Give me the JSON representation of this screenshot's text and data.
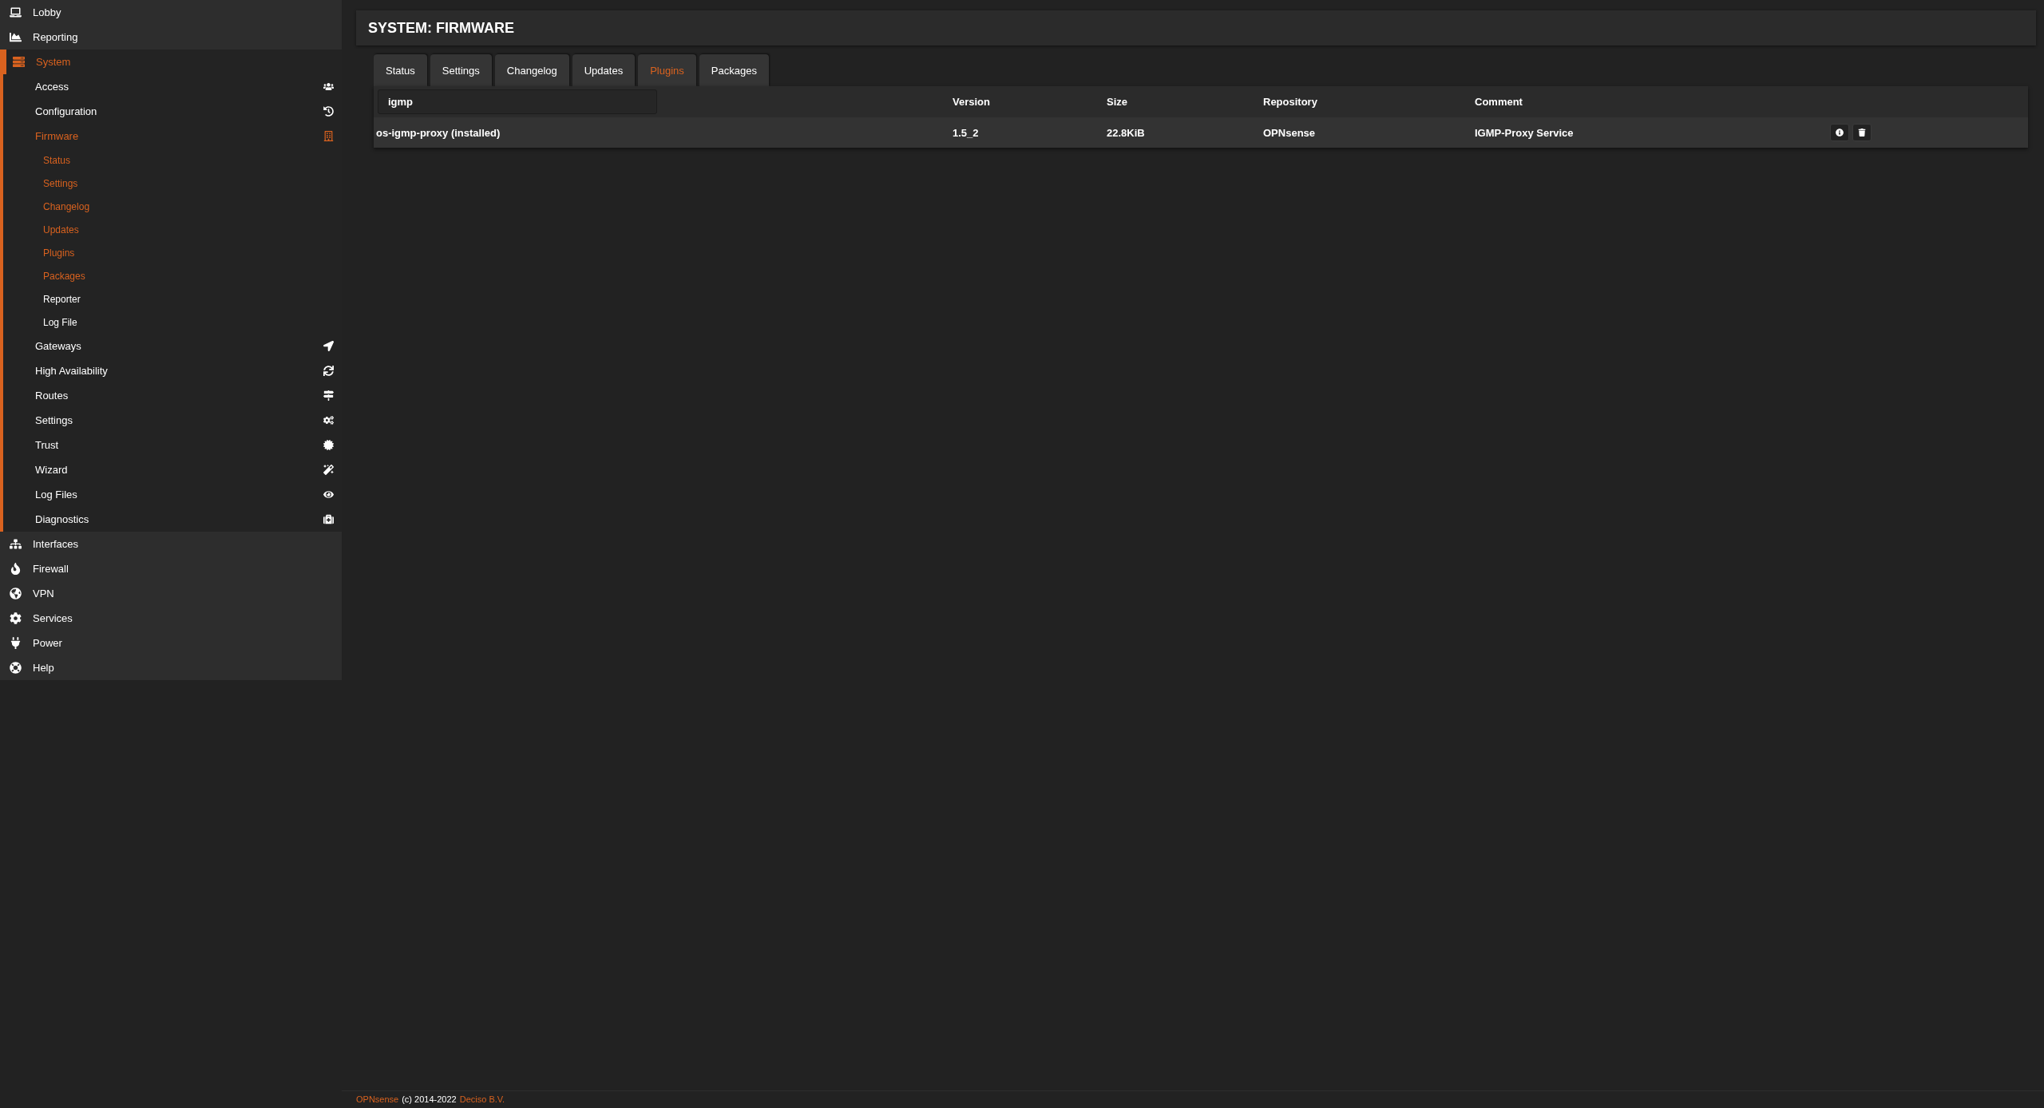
{
  "sidebar": {
    "items": [
      {
        "label": "Lobby",
        "selected": false
      },
      {
        "label": "Reporting",
        "selected": false
      },
      {
        "label": "System",
        "selected": true,
        "children": [
          {
            "label": "Access",
            "selected": false
          },
          {
            "label": "Configuration",
            "selected": false
          },
          {
            "label": "Firmware",
            "selected": true,
            "children": [
              {
                "label": "Status",
                "selected": true
              },
              {
                "label": "Settings",
                "selected": true
              },
              {
                "label": "Changelog",
                "selected": true
              },
              {
                "label": "Updates",
                "selected": true
              },
              {
                "label": "Plugins",
                "selected": true
              },
              {
                "label": "Packages",
                "selected": true
              },
              {
                "label": "Reporter",
                "selected": false
              },
              {
                "label": "Log File",
                "selected": false
              }
            ]
          },
          {
            "label": "Gateways",
            "selected": false
          },
          {
            "label": "High Availability",
            "selected": false
          },
          {
            "label": "Routes",
            "selected": false
          },
          {
            "label": "Settings",
            "selected": false
          },
          {
            "label": "Trust",
            "selected": false
          },
          {
            "label": "Wizard",
            "selected": false
          },
          {
            "label": "Log Files",
            "selected": false
          },
          {
            "label": "Diagnostics",
            "selected": false
          }
        ]
      },
      {
        "label": "Interfaces",
        "selected": false
      },
      {
        "label": "Firewall",
        "selected": false
      },
      {
        "label": "VPN",
        "selected": false
      },
      {
        "label": "Services",
        "selected": false
      },
      {
        "label": "Power",
        "selected": false
      },
      {
        "label": "Help",
        "selected": false
      }
    ]
  },
  "page_title": "SYSTEM: FIRMWARE",
  "tabs": [
    {
      "label": "Status",
      "selected": false
    },
    {
      "label": "Settings",
      "selected": false
    },
    {
      "label": "Changelog",
      "selected": false
    },
    {
      "label": "Updates",
      "selected": false
    },
    {
      "label": "Plugins",
      "selected": true
    },
    {
      "label": "Packages",
      "selected": false
    }
  ],
  "table": {
    "search": {
      "value": "igmp"
    },
    "columns": [
      "Version",
      "Size",
      "Repository",
      "Comment"
    ],
    "rows": [
      {
        "name": "os-igmp-proxy (installed)",
        "version": "1.5_2",
        "size": "22.8KiB",
        "repository": "OPNsense",
        "comment": "IGMP-Proxy Service"
      }
    ]
  },
  "footer": {
    "brand": "OPNsense",
    "copyright": "(c) 2014-2022",
    "company": "Deciso B.V."
  }
}
